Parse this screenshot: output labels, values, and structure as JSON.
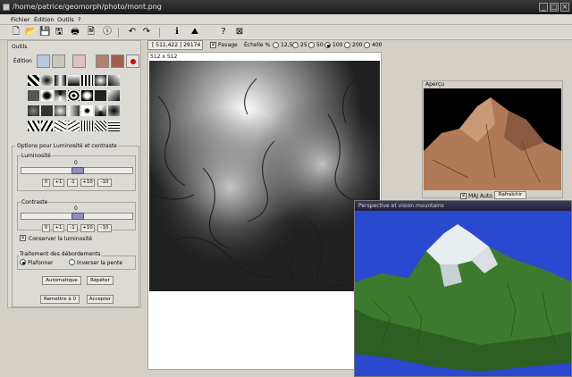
{
  "window": {
    "title": "/home/patrice/geomorph/photo/mont.png",
    "buttons": [
      "_",
      "□",
      "×"
    ]
  },
  "menu": [
    "Fichier",
    "Édition",
    "Outils",
    "?"
  ],
  "toolbar": {
    "icons": [
      "new-icon",
      "open-icon",
      "save-icon",
      "save-as-icon",
      "print-icon",
      "info-icon",
      "undo-icon",
      "redo-icon",
      "properties-icon",
      "render-icon",
      "help-icon",
      "close-icon"
    ]
  },
  "coords": {
    "position": "[ 511,422 ] 29174",
    "pavage_label": "Pavage",
    "scale_label": "Échelle %",
    "scale_options": [
      "12,5",
      "25",
      "50",
      "100",
      "200",
      "400"
    ],
    "scale_selected": "100",
    "size": "512 x 512"
  },
  "tools": {
    "title": "Outils",
    "edition_label": "Édition",
    "options_title": "Options pour Luminosité et contraste",
    "luminosity": {
      "label": "Luminosité",
      "value": "0",
      "buttons": [
        "0",
        "+1",
        "-1",
        "+10",
        "-10"
      ]
    },
    "contrast": {
      "label": "Contraste",
      "value": "0",
      "buttons": [
        "0",
        "+1",
        "-1",
        "+10",
        "-10"
      ]
    },
    "preserve_luminosity": "Conserver la luminosité",
    "overflow": {
      "label": "Traitement des débordements",
      "option_cap": "Plafonner",
      "option_invert": "Inverser la pente"
    },
    "btn_auto": "Automatique",
    "btn_repeat": "Répéter",
    "btn_reset": "Remettre à 0",
    "btn_accept": "Accepter"
  },
  "preview": {
    "title": "Aperçu",
    "maj_auto": "MAJ Auto",
    "refresh": "Rafraîchir"
  },
  "render_window": {
    "title": "Perspective et vision mountains"
  },
  "colors": {
    "accent_slider": "#8f8ec0",
    "water": "#2040c8"
  }
}
